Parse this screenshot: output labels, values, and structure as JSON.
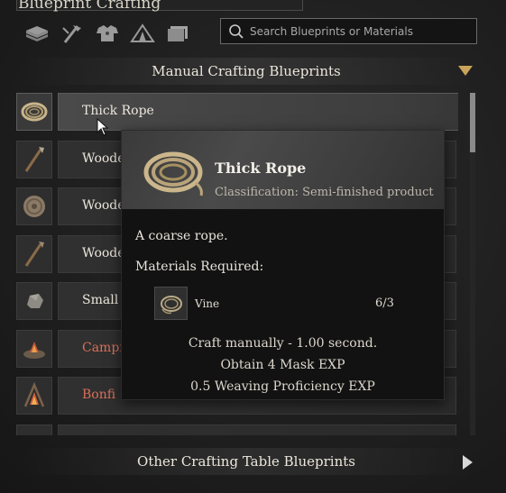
{
  "window": {
    "title": "Blueprint Crafting"
  },
  "categories": [
    {
      "icon": "materials-stack-icon"
    },
    {
      "icon": "tools-icon"
    },
    {
      "icon": "armor-icon"
    },
    {
      "icon": "tent-icon"
    },
    {
      "icon": "furniture-icon"
    }
  ],
  "search": {
    "placeholder": "Search Blueprints or Materials",
    "value": ""
  },
  "sections": {
    "manual": {
      "label": "Manual Crafting Blueprints",
      "expanded": true
    },
    "other": {
      "label": "Other Crafting Table Blueprints",
      "expanded": false
    }
  },
  "blueprints": [
    {
      "label": "Thick Rope",
      "icon": "rope-icon",
      "selected": true,
      "locked": false
    },
    {
      "label": "Woode",
      "icon": "spear-icon",
      "selected": false,
      "locked": false
    },
    {
      "label": "Woode",
      "icon": "wooden-shield-icon",
      "selected": false,
      "locked": false
    },
    {
      "label": "Woode",
      "icon": "spear-icon",
      "selected": false,
      "locked": false
    },
    {
      "label": "Small S",
      "icon": "stone-icon",
      "selected": false,
      "locked": false
    },
    {
      "label": "Campf",
      "icon": "campfire-icon",
      "selected": false,
      "locked": true
    },
    {
      "label": "Bonfi",
      "icon": "bonfire-icon",
      "selected": false,
      "locked": true
    },
    {
      "label": "",
      "icon": "item-icon",
      "selected": false,
      "locked": false
    }
  ],
  "tooltip": {
    "name": "Thick Rope",
    "classification": "Classification: Semi-finished product",
    "description": "A coarse rope.",
    "materials_label": "Materials Required:",
    "materials": [
      {
        "name": "Vine",
        "count": "6/3",
        "icon": "vine-icon"
      }
    ],
    "lines": [
      "Craft manually - 1.00 second.",
      "Obtain 4 Mask EXP",
      "0.5 Weaving Proficiency EXP"
    ]
  },
  "colors": {
    "accent": "#c9a45a",
    "locked_text": "#d9705a",
    "text": "#ece7dd"
  }
}
